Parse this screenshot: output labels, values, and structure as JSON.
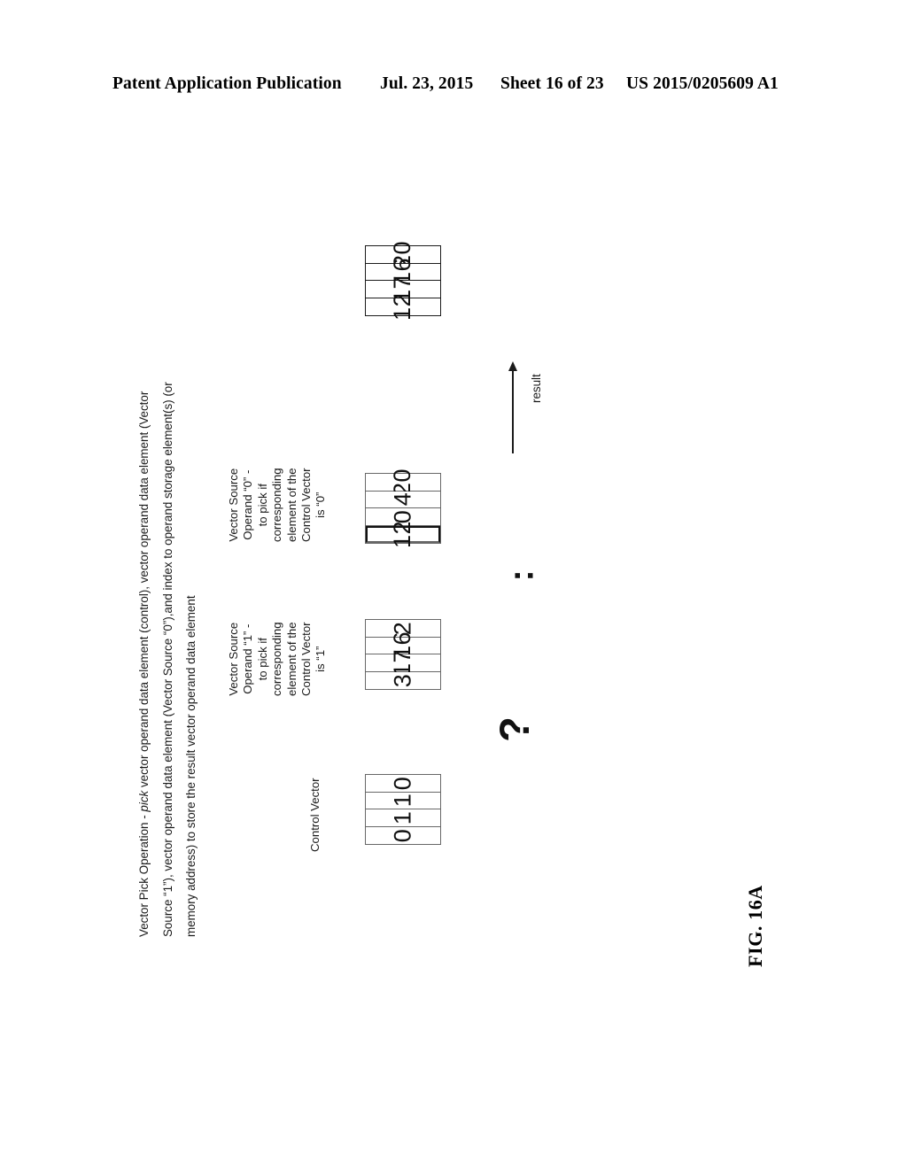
{
  "header": {
    "publication": "Patent Application Publication",
    "date": "Jul. 23, 2015",
    "sheet": "Sheet 16 of 23",
    "patent_number": "US 2015/0205609 A1"
  },
  "description": {
    "line1_a": "Vector Pick Operation - ",
    "line1_i": "pick",
    "line1_b": " vector operand data element (control), vector operand data element (Vector",
    "line2": "Source “1”), vector operand data element (Vector Source “0”),and index to operand storage element(s) (or",
    "line3": "memory address) to store the result vector operand data element"
  },
  "figure": {
    "caption": "FIG.  16A",
    "result_arrow_label": "result",
    "glyph_question": "?",
    "glyph_colon": ":",
    "vectors": [
      {
        "id": "result-vector",
        "label": "",
        "values": [
          "20",
          "16",
          "17",
          "12"
        ],
        "emphasized_index": -1,
        "weight": "bold"
      },
      {
        "id": "vector-source-0",
        "label": "Vector Source Operand “0” - to pick if corresponding element of the Control Vector is “0”",
        "label_lines": [
          "Vector Source",
          "Operand “0” -",
          "to pick if",
          "corresponding",
          "element of the",
          "Control Vector",
          "is “0”"
        ],
        "values": [
          "20",
          "4",
          "0",
          "12"
        ],
        "emphasized_index": 3,
        "weight": "light"
      },
      {
        "id": "vector-source-1",
        "label": "Vector Source Operand “1” - to pick if corresponding element of the Control Vector is “1”",
        "label_lines": [
          "Vector Source",
          "Operand “1” -",
          "to pick if",
          "corresponding",
          "element of the",
          "Control Vector",
          "is “1”"
        ],
        "values": [
          "2",
          "16",
          "17",
          "3"
        ],
        "emphasized_index": -1,
        "weight": "light"
      },
      {
        "id": "control-vector",
        "label": "Control Vector",
        "label_lines": [
          "Control Vector"
        ],
        "values": [
          "0",
          "1",
          "1",
          "0"
        ],
        "emphasized_index": -1,
        "weight": "light"
      }
    ]
  }
}
